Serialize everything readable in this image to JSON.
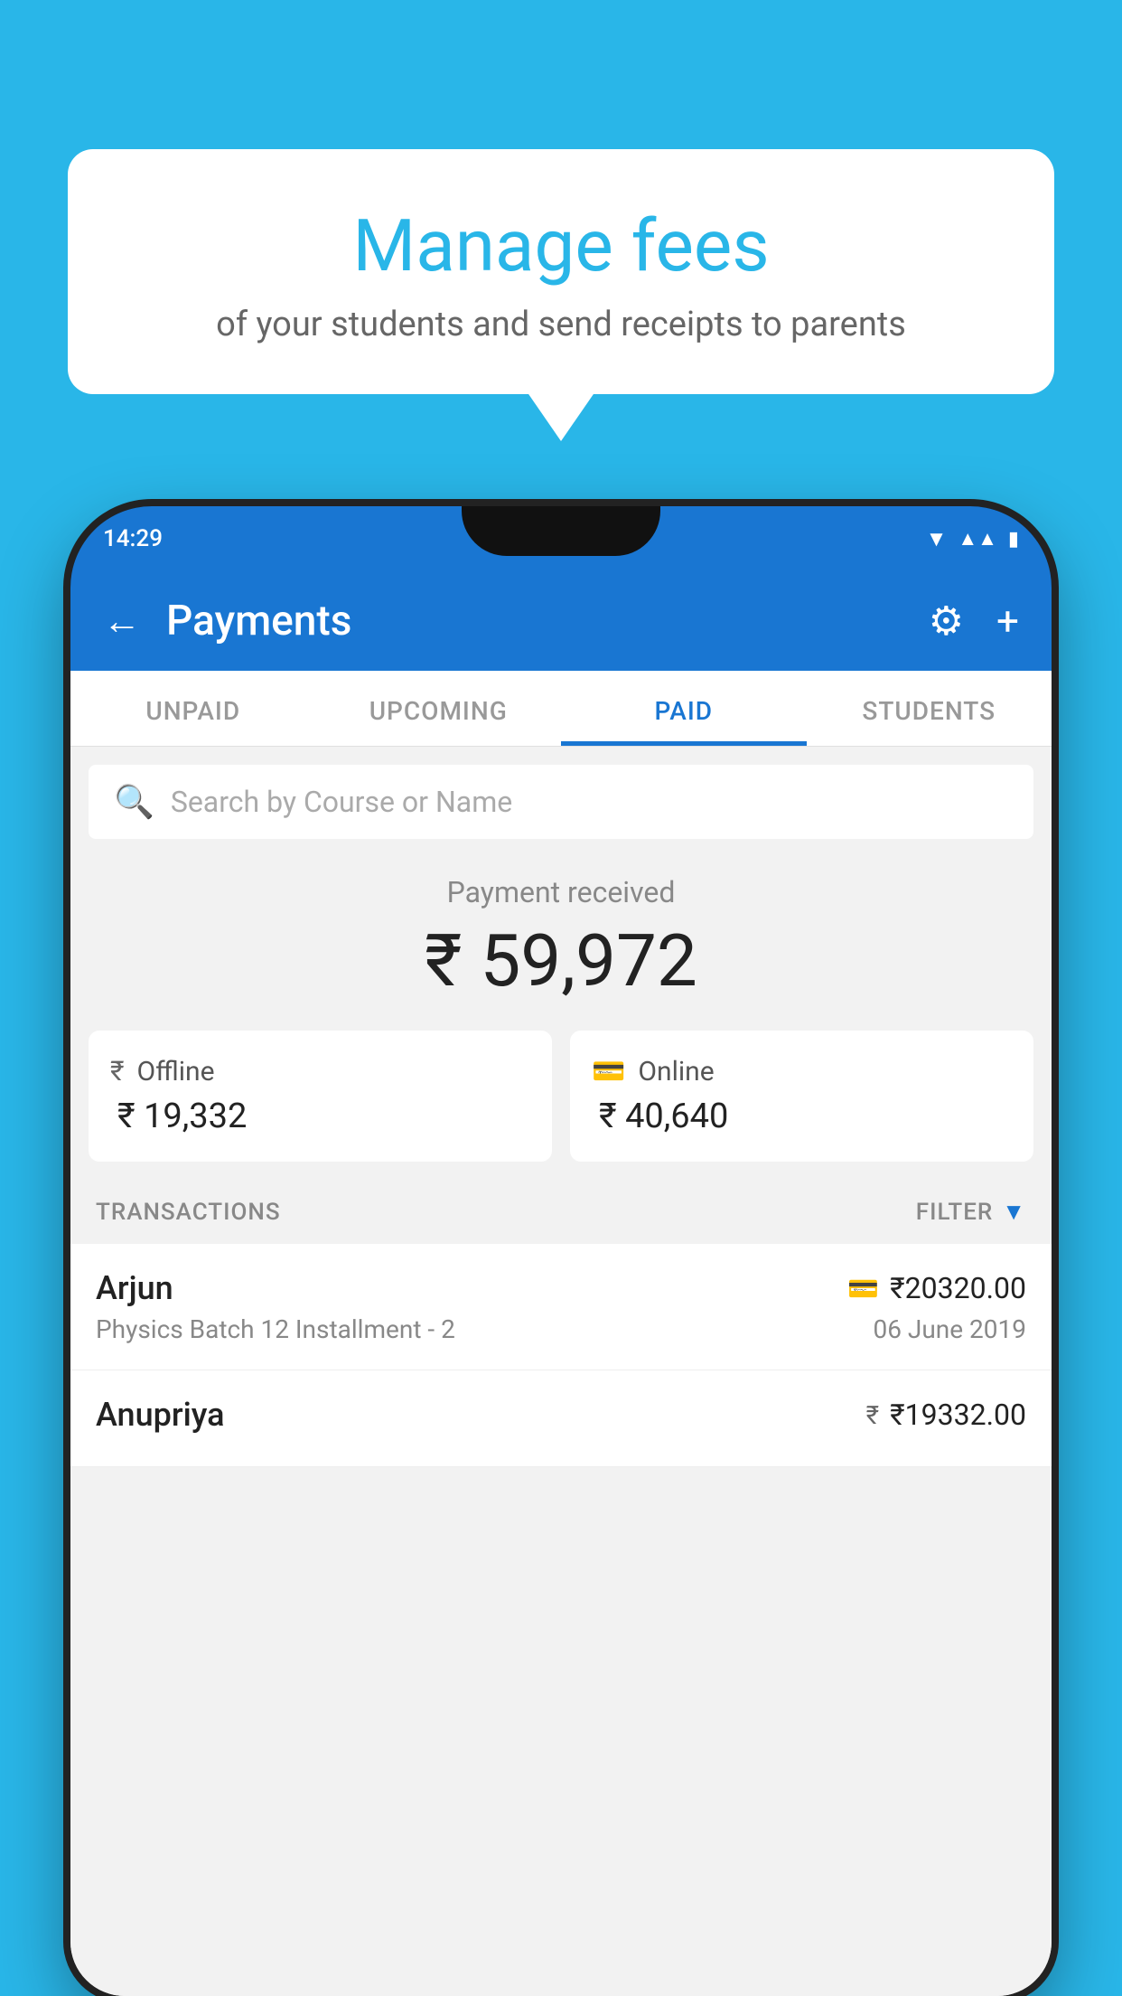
{
  "background": {
    "color": "#29b6e8"
  },
  "bubble": {
    "title": "Manage fees",
    "subtitle": "of your students and send receipts to parents"
  },
  "status_bar": {
    "time": "14:29"
  },
  "app_bar": {
    "title": "Payments",
    "back_label": "←",
    "settings_label": "⚙",
    "add_label": "+"
  },
  "tabs": [
    {
      "label": "UNPAID",
      "active": false
    },
    {
      "label": "UPCOMING",
      "active": false
    },
    {
      "label": "PAID",
      "active": true
    },
    {
      "label": "STUDENTS",
      "active": false
    }
  ],
  "search": {
    "placeholder": "Search by Course or Name"
  },
  "payment_summary": {
    "label": "Payment received",
    "amount": "₹ 59,972"
  },
  "payment_cards": [
    {
      "label": "Offline",
      "amount": "₹ 19,332",
      "icon": "₹"
    },
    {
      "label": "Online",
      "amount": "₹ 40,640",
      "icon": "💳"
    }
  ],
  "transactions_header": {
    "label": "TRANSACTIONS",
    "filter_label": "FILTER"
  },
  "transactions": [
    {
      "name": "Arjun",
      "description": "Physics Batch 12 Installment - 2",
      "amount": "₹20320.00",
      "date": "06 June 2019",
      "payment_icon": "card"
    },
    {
      "name": "Anupriya",
      "description": "",
      "amount": "₹19332.00",
      "date": "",
      "payment_icon": "cash"
    }
  ]
}
